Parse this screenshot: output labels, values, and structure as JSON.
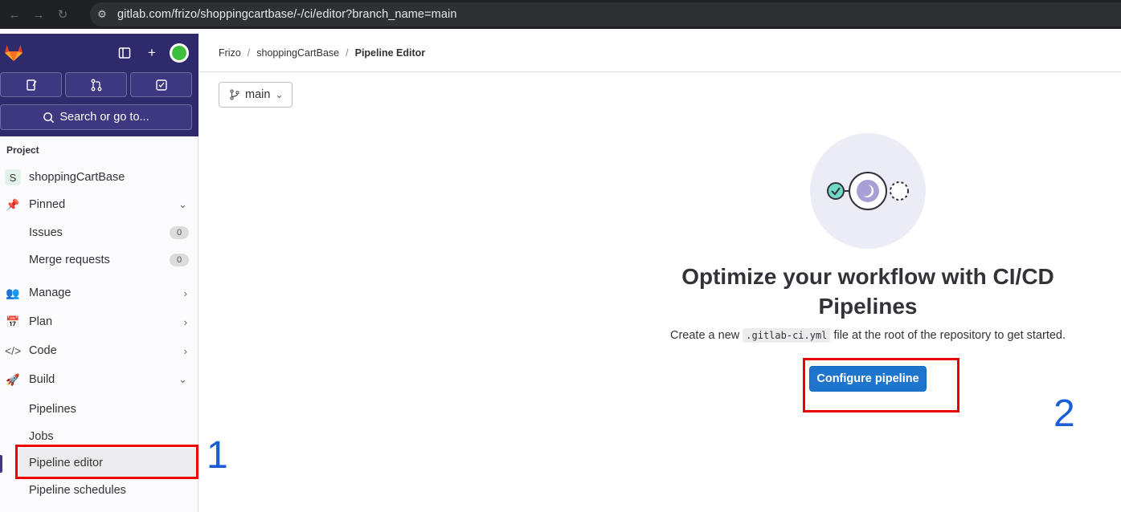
{
  "browser": {
    "url": "gitlab.com/frizo/shoppingcartbase/-/ci/editor?branch_name=main"
  },
  "sidebar": {
    "search_label": "Search or go to...",
    "section_title": "Project",
    "project_initial": "S",
    "project_name": "shoppingCartBase",
    "pinned": "Pinned",
    "issues": {
      "label": "Issues",
      "count": "0"
    },
    "merge_requests": {
      "label": "Merge requests",
      "count": "0"
    },
    "manage": "Manage",
    "plan": "Plan",
    "code": "Code",
    "build": "Build",
    "pipelines": "Pipelines",
    "jobs": "Jobs",
    "pipeline_editor": "Pipeline editor",
    "pipeline_schedules": "Pipeline schedules"
  },
  "breadcrumb": {
    "owner": "Frizo",
    "project": "shoppingCartBase",
    "current": "Pipeline Editor"
  },
  "branch": {
    "name": "main"
  },
  "empty_state": {
    "title": "Optimize your workflow with CI/CD Pipelines",
    "desc_prefix": "Create a new",
    "desc_code": ".gitlab-ci.yml",
    "desc_suffix": "file at the root of the repository to get started.",
    "button": "Configure pipeline"
  },
  "annotations": {
    "one": "1",
    "two": "2"
  },
  "colors": {
    "sidebar_top": "#2f2a6b",
    "primary": "#1f75cb",
    "annotation_box": "#e00000",
    "annotation_number": "#1a5fd6"
  }
}
